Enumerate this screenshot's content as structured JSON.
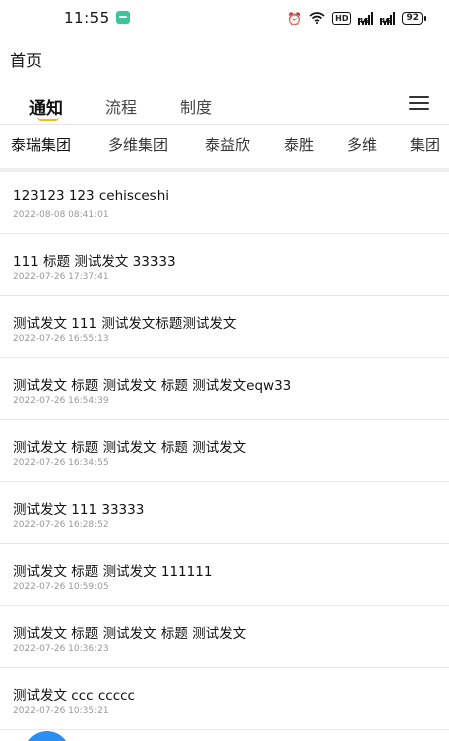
{
  "status_bar": {
    "time": "11:55",
    "hd": "HD",
    "signal_1": "4G",
    "signal_2": "4G",
    "battery": "92",
    "icons": [
      "chat-icon",
      "alarm-icon",
      "wifi-icon",
      "hd-icon",
      "signal-icon",
      "signal-icon",
      "battery-icon"
    ]
  },
  "header": {
    "title": "首页"
  },
  "main_tabs": [
    {
      "label": "通知",
      "active": true
    },
    {
      "label": "流程",
      "active": false
    },
    {
      "label": "制度",
      "active": false
    }
  ],
  "sub_tabs": [
    {
      "label": "泰瑞集团",
      "active": true
    },
    {
      "label": "多维集团",
      "active": false
    },
    {
      "label": "泰益欣",
      "active": false
    },
    {
      "label": "泰胜",
      "active": false
    },
    {
      "label": "多维",
      "active": false
    },
    {
      "label": "集团",
      "active": false
    }
  ],
  "notices": [
    {
      "title": "123123 123 cehisceshi",
      "date": "2022-08-08 08:41:01"
    },
    {
      "title": "111 标题 测试发文 33333",
      "date": "2022-07-26 17:37:41"
    },
    {
      "title": "测试发文 111 测试发文标题测试发文",
      "date": "2022-07-26 16:55:13"
    },
    {
      "title": "测试发文 标题 测试发文 标题 测试发文eqw33",
      "date": "2022-07-26 16:54:39"
    },
    {
      "title": "测试发文 标题 测试发文 标题 测试发文",
      "date": "2022-07-26 16:34:55"
    },
    {
      "title": "测试发文 111 33333",
      "date": "2022-07-26 16:28:52"
    },
    {
      "title": "测试发文 标题 测试发文 111111",
      "date": "2022-07-26 10:59:05"
    },
    {
      "title": "测试发文 标题 测试发文 标题 测试发文",
      "date": "2022-07-26 10:36:23"
    },
    {
      "title": "测试发文 ccc ccccc",
      "date": "2022-07-26 10:35:21"
    }
  ],
  "colors": {
    "tab_indicator": "#f3b72a",
    "fab": "#2a8ff0",
    "chat_icon": "#3cc59a"
  }
}
